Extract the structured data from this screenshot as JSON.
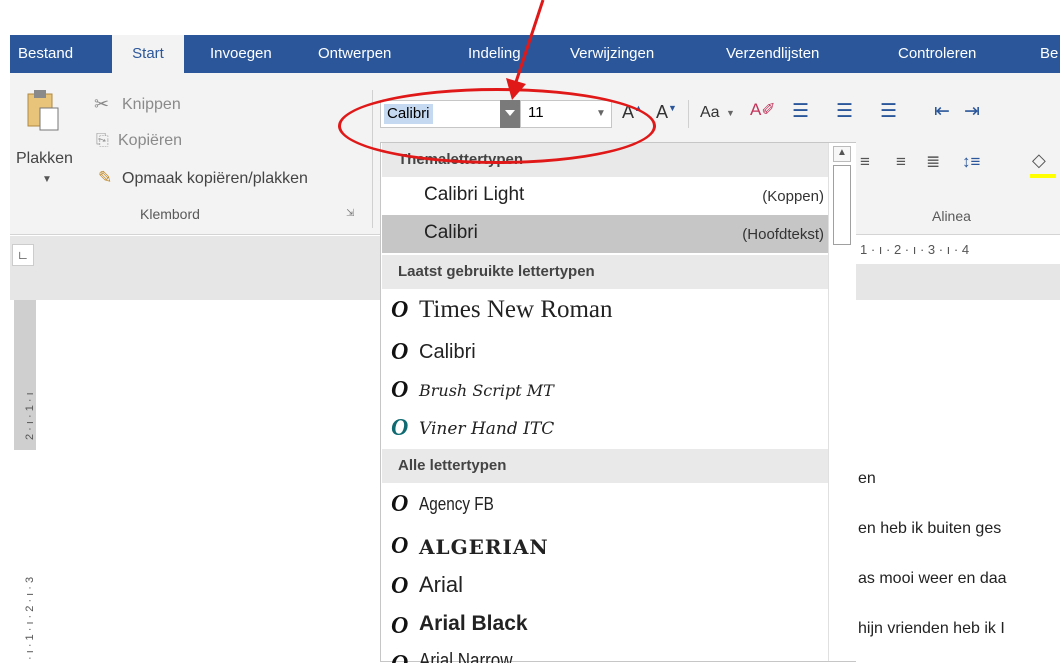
{
  "ribbon_tabs": [
    {
      "label": "Bestand"
    },
    {
      "label": "Start"
    },
    {
      "label": "Invoegen"
    },
    {
      "label": "Ontwerpen"
    },
    {
      "label": "Indeling"
    },
    {
      "label": "Verwijzingen"
    },
    {
      "label": "Verzendlijsten"
    },
    {
      "label": "Controleren"
    },
    {
      "label": "Be"
    }
  ],
  "clipboard": {
    "paste_label": "Plakken",
    "cut_label": "Knippen",
    "copy_label": "Kopiëren",
    "format_painter_label": "Opmaak kopiëren/plakken",
    "group_label": "Klembord"
  },
  "font": {
    "name_value": "Calibri",
    "size_value": "11",
    "case_button": "Aa"
  },
  "paragraph": {
    "group_label": "Alinea"
  },
  "dropdown": {
    "section_theme": "Themalettertypen",
    "theme_fonts": [
      {
        "name": "Calibri Light",
        "tag": "(Koppen)"
      },
      {
        "name": "Calibri",
        "tag": "(Hoofdtekst)"
      }
    ],
    "section_recent": "Laatst gebruikte lettertypen",
    "recent_fonts": [
      "Times New Roman",
      "Calibri",
      "Brush Script MT",
      "Viner Hand ITC"
    ],
    "section_all": "Alle lettertypen",
    "all_fonts": [
      "Agency FB",
      "ALGERIAN",
      "Arial",
      "Arial Black",
      "Arial Narrow"
    ]
  },
  "ruler": {
    "horizontal": "1 · ı · 2 · ı · 3 · ı · 4",
    "vertical_top": "2 · ı · 1 · ı",
    "vertical_bottom": "· ı · 1 · ı · 2 · ı · 3"
  },
  "document": {
    "lines": [
      "en",
      "en heb ik buiten ges",
      "as mooi weer en daa",
      "hijn vrienden heb ik I"
    ]
  },
  "colors": {
    "accent": "#2b579a",
    "annotation": "#e01818",
    "selection": "#c5d9f1",
    "highlight_bar": "#ffff00"
  },
  "icons": [
    "paste-icon",
    "cut-icon",
    "copy-icon",
    "format-painter-icon",
    "truetype-font-icon",
    "arrow-annotation"
  ]
}
